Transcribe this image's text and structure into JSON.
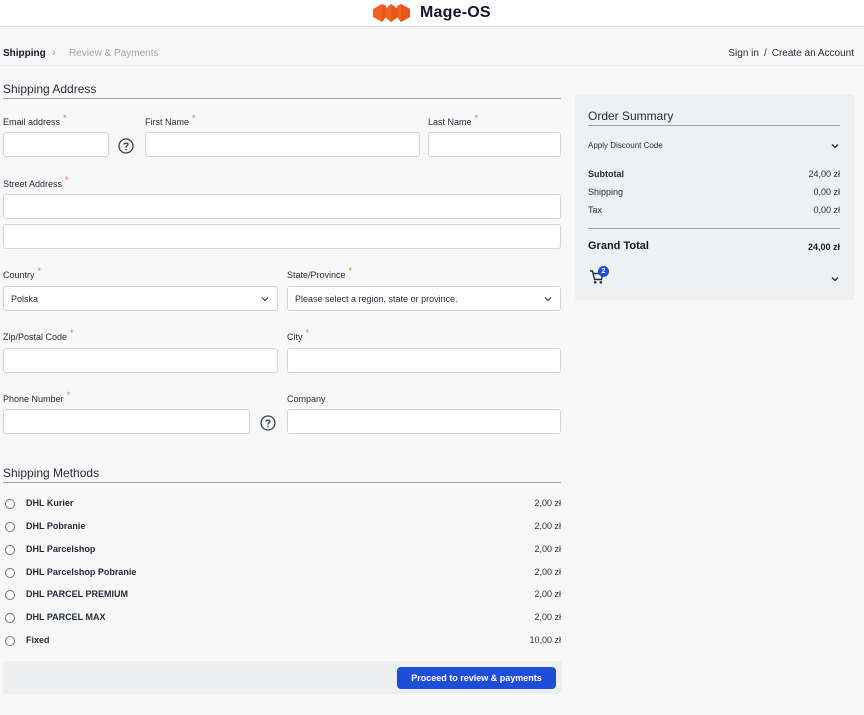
{
  "brand": {
    "name": "Mage-OS",
    "logo_color": "#f26322"
  },
  "nav": {
    "steps": [
      {
        "label": "Shipping",
        "active": true
      },
      {
        "label": "Review & Payments",
        "active": false
      }
    ],
    "separator": "›",
    "sign_in": "Sign in",
    "divider": "/",
    "create_account": "Create an Account"
  },
  "shipping_address": {
    "title": "Shipping Address",
    "required_mark": "*",
    "email": {
      "label": "Email address",
      "value": ""
    },
    "first_name": {
      "label": "First Name",
      "value": ""
    },
    "last_name": {
      "label": "Last Name",
      "value": ""
    },
    "street": {
      "label": "Street Address",
      "line1": "",
      "line2": ""
    },
    "country": {
      "label": "Country",
      "value": "Polska"
    },
    "region": {
      "label": "State/Province",
      "value": "Please select a region, state or province."
    },
    "zip": {
      "label": "Zip/Postal Code",
      "value": ""
    },
    "city": {
      "label": "City",
      "value": ""
    },
    "phone": {
      "label": "Phone Number",
      "value": ""
    },
    "company": {
      "label": "Company",
      "value": ""
    }
  },
  "shipping_methods": {
    "title": "Shipping Methods",
    "items": [
      {
        "name": "DHL Kurier",
        "price": "2,00 zł"
      },
      {
        "name": "DHL Pobranie",
        "price": "2,00 zł"
      },
      {
        "name": "DHL Parcelshop",
        "price": "2,00 zł"
      },
      {
        "name": "DHL Parcelshop Pobranie",
        "price": "2,00 zł"
      },
      {
        "name": "DHL PARCEL PREMIUM",
        "price": "2,00 zł"
      },
      {
        "name": "DHL PARCEL MAX",
        "price": "2,00 zł"
      },
      {
        "name": "Fixed",
        "price": "10,00 zł"
      }
    ]
  },
  "proceed_label": "Proceed to review & payments",
  "summary": {
    "title": "Order Summary",
    "discount_label": "Apply Discount Code",
    "subtotal_label": "Subtotal",
    "subtotal_value": "24,00 zł",
    "shipping_label": "Shipping",
    "shipping_value": "0,00 zł",
    "tax_label": "Tax",
    "tax_value": "0,00 zł",
    "grand_total_label": "Grand Total",
    "grand_total_value": "24,00 zł",
    "cart_count": "2"
  },
  "colors": {
    "primary": "#1e4ed8",
    "required": "#f97316",
    "logo": "#f26322"
  },
  "icons": [
    "mage-os-logo-icon",
    "help-circle-icon",
    "chevron-down-icon",
    "cart-icon",
    "radio-icon"
  ]
}
